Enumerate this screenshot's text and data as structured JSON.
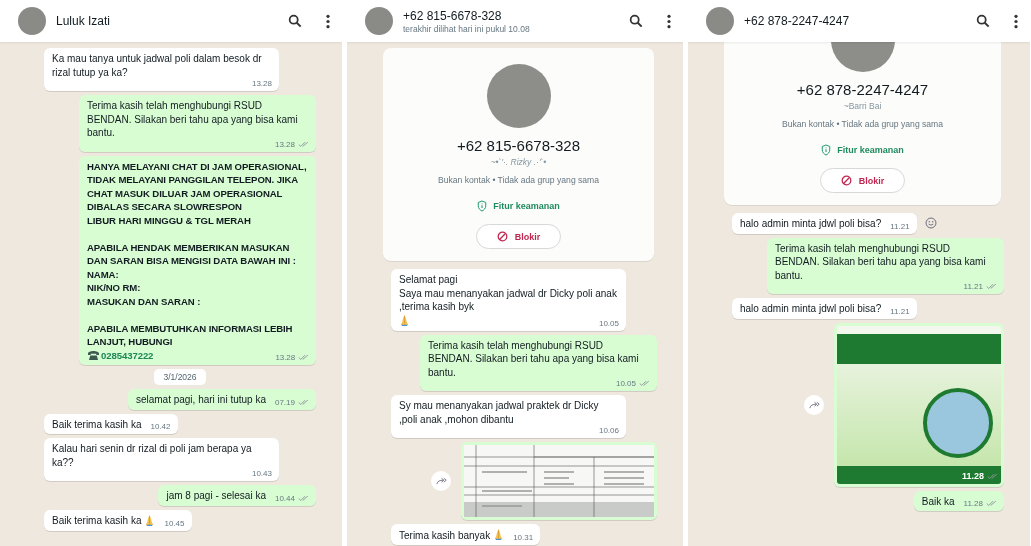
{
  "panels": [
    {
      "header": {
        "name": "Luluk Izati"
      },
      "messages": [
        {
          "kind": "in",
          "text": "Ka mau tanya untuk jadwal poli dalam besok dr rizal tutup ya ka?",
          "time": "13.28"
        },
        {
          "kind": "out",
          "text": "Terima kasih telah menghubungi RSUD BENDAN. Silakan beri tahu apa yang bisa kami bantu.",
          "time": "13.28",
          "delivered": true
        },
        {
          "kind": "out",
          "bold": true,
          "text": "HANYA MELAYANI CHAT DI JAM OPERASIONAL, TIDAK MELAYANI PANGGILAN TELEPON. JIKA CHAT MASUK DILUAR JAM OPERASIONAL DIBALAS SECARA SLOWRESPON\nLIBUR HARI MINGGU & TGL MERAH\n\nAPABILA HENDAK MEMBERIKAN MASUKAN DAN SARAN BISA MENGISI DATA BAWAH INI :\nNAMA:\nNIK/NO RM:\nMASUKAN DAN SARAN :\n\nAPABILA MEMBUTUHKAN INFORMASI LEBIH LANJUT, HUBUNGI",
          "phone": "0285437222",
          "time": "13.28",
          "delivered": true
        },
        {
          "kind": "date",
          "text": "3/1/2026"
        },
        {
          "kind": "out",
          "text": "selamat pagi, hari ini tutup ka",
          "time": "07.19",
          "delivered": true
        },
        {
          "kind": "in",
          "text": "Baik terima kasih ka",
          "time": "10.42"
        },
        {
          "kind": "in",
          "text": "Kalau hari senin dr rizal di poli jam berapa ya ka??",
          "time": "10.43"
        },
        {
          "kind": "out",
          "text": "jam 8 pagi - selesai ka",
          "time": "10.44",
          "delivered": true
        },
        {
          "kind": "in",
          "text": "Baik terima kasih ka",
          "pray_emoji": true,
          "time": "10.45"
        }
      ]
    },
    {
      "header": {
        "name": "+62 815-6678-328",
        "subtitle": "terakhir dilihat hari ini pukul 10.08"
      },
      "messages": [
        {
          "kind": "contact_card",
          "scrolled": false,
          "number": "+62 815-6678-328",
          "about": "~•`'·. Rizky .·'`•",
          "info": "Bukan kontak • Tidak ada grup yang sama",
          "safety": "Fitur keamanan",
          "block": "Blokir"
        },
        {
          "kind": "in",
          "text": "Selamat pagi\nSaya mau menanyakan jadwal dr Dicky poli anak ,terima kasih byk",
          "pray_emoji": true,
          "time": "10.05"
        },
        {
          "kind": "out",
          "text": "Terima kasih telah menghubungi RSUD BENDAN. Silakan beri tahu apa yang bisa kami bantu.",
          "time": "10.05",
          "delivered": true
        },
        {
          "kind": "in",
          "text": "Sy mau menanyakan jadwal praktek dr Dicky ,poli anak ,mohon dibantu",
          "time": "10.06"
        },
        {
          "kind": "table_image",
          "forward": true
        },
        {
          "kind": "in",
          "text": "Terima kasih banyak",
          "pray_emoji": true,
          "time": "10.31"
        }
      ]
    },
    {
      "header": {
        "name": "+62 878-2247-4247"
      },
      "messages": [
        {
          "kind": "contact_card",
          "scrolled": true,
          "number": "+62 878-2247-4247",
          "about": "~Barri Bai",
          "info": "Bukan kontak • Tidak ada grup yang sama",
          "safety": "Fitur keamanan",
          "block": "Blokir"
        },
        {
          "kind": "in",
          "text": "halo admin minta jdwl poli bisa?",
          "time": "11.21",
          "react": true
        },
        {
          "kind": "out",
          "text": "Terima kasih telah menghubungi RSUD BENDAN. Silakan beri tahu apa yang bisa kami bantu.",
          "time": "11.21",
          "delivered": true
        },
        {
          "kind": "in",
          "text": "halo admin minta jdwl poli bisa?",
          "time": "11.21"
        },
        {
          "kind": "poster_image",
          "forward": true,
          "time": "11.28",
          "delivered": true
        },
        {
          "kind": "out",
          "text": "Baik ka",
          "time": "11.28",
          "delivered": true
        }
      ]
    }
  ]
}
